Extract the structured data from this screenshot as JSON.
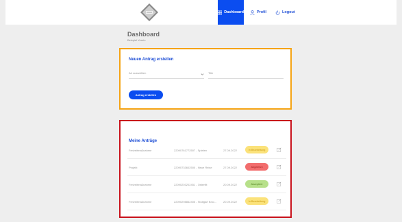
{
  "header": {
    "logo_icon": "badge-logo-icon",
    "nav": [
      {
        "label": "Dashboard",
        "icon": "dashboard-icon",
        "active": true
      },
      {
        "label": "Profil",
        "icon": "user-icon",
        "active": false
      },
      {
        "label": "Logout",
        "icon": "power-icon",
        "active": false
      }
    ]
  },
  "page": {
    "title": "Dashboard",
    "subtitle": "Beispiel Verein"
  },
  "new_request": {
    "heading": "Neuen Antrag erstellen",
    "select_placeholder": "Art auswählen",
    "title_placeholder": "Title",
    "create_label": "Antrag erstellen"
  },
  "my_requests": {
    "heading": "Meine Anträge",
    "rows": [
      {
        "type": "Freizeitmaßnahme",
        "number": "22090761772507 - Spielen",
        "date": "27.09.2022",
        "status": "In Bearbeitung",
        "status_color": "#fbe27a",
        "status_text_color": "#c99a13"
      },
      {
        "type": "Projekt",
        "number": "22090733602500 - Neue Reise",
        "date": "27.09.2022",
        "status": "Abgelehnt",
        "status_color": "#f26d6d",
        "status_text_color": "#9b1a1a"
      },
      {
        "type": "Freizeitmaßnahme",
        "number": "22090203202451 - Osterfilt",
        "date": "20.09.2022",
        "status": "Akzeptiert",
        "status_color": "#b7e08a",
        "status_text_color": "#4f7d1d"
      },
      {
        "type": "Freizeitmaßnahme",
        "number": "22090298862405 - Stuttgart Broc...",
        "date": "20.09.2022",
        "status": "In Bearbeitung",
        "status_color": "#fbe27a",
        "status_text_color": "#c99a13"
      }
    ]
  }
}
